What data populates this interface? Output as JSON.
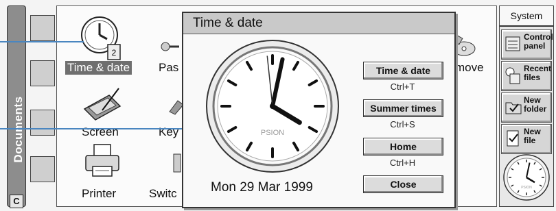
{
  "sidebar": {
    "tab_label": "Documents",
    "c_key": "C"
  },
  "control_panel": {
    "items": [
      {
        "label": "Time & date",
        "icon": "clock-calendar-icon",
        "selected": true
      },
      {
        "label": "Pas",
        "icon": "key-icon"
      },
      {
        "label": "move",
        "icon": "disc-icon"
      },
      {
        "label": "Screen",
        "icon": "screen-icon"
      },
      {
        "label": "Key",
        "icon": "keyboard-icon"
      },
      {
        "label": "Printer",
        "icon": "printer-icon"
      },
      {
        "label": "Switc",
        "icon": "switch-icon"
      }
    ]
  },
  "dialog": {
    "title": "Time & date",
    "date_text": "Mon 29 Mar 1999",
    "clock": {
      "brand": "PSION",
      "hour": 4,
      "minute": 2,
      "second": 59
    },
    "buttons": [
      {
        "label": "Time & date",
        "shortcut": "Ctrl+T"
      },
      {
        "label": "Summer times",
        "shortcut": "Ctrl+S"
      },
      {
        "label": "Home",
        "shortcut": "Ctrl+H"
      },
      {
        "label": "Close",
        "shortcut": ""
      }
    ]
  },
  "toolbar": {
    "title": "System",
    "buttons": [
      {
        "label": "Control panel",
        "icon": "control-panel-icon"
      },
      {
        "label": "Recent files",
        "icon": "recent-files-icon"
      },
      {
        "label": "New folder",
        "icon": "new-folder-icon"
      },
      {
        "label": "New file",
        "icon": "new-file-icon"
      }
    ],
    "mini_clock": {
      "brand": "PSION",
      "hour": 4,
      "minute": 2
    }
  }
}
